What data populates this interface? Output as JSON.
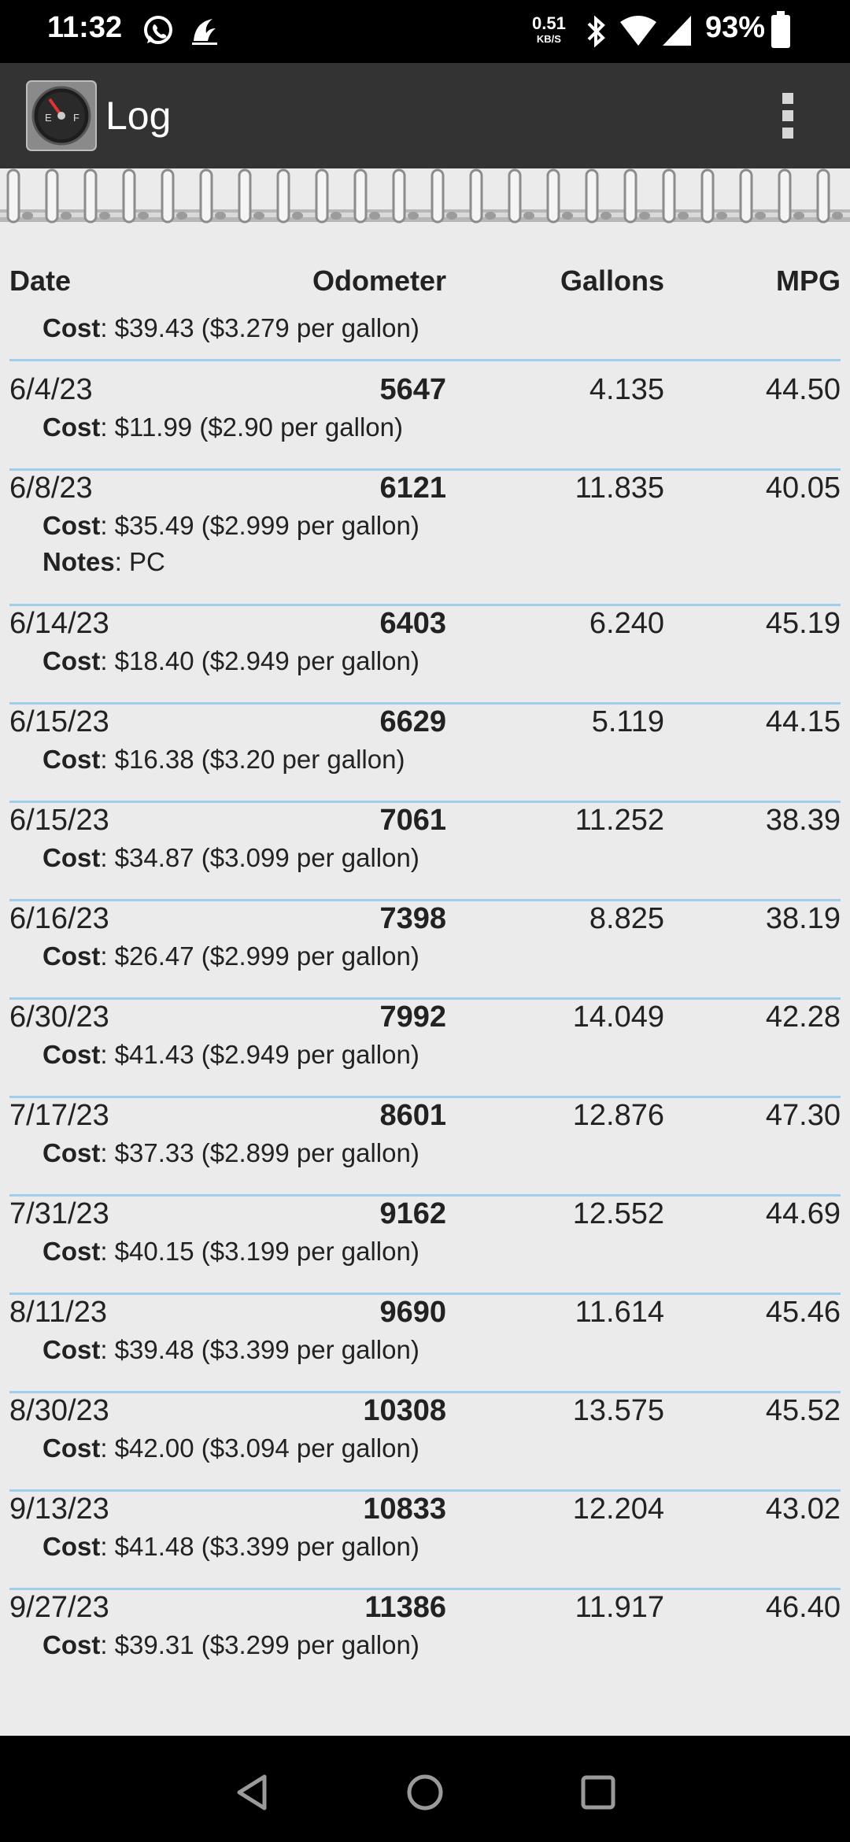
{
  "status_bar": {
    "time": "11:32",
    "net_speed_value": "0.51",
    "net_speed_unit": "KB/S",
    "battery": "93%"
  },
  "app_bar": {
    "title": "Log",
    "icon": "fuel-gauge-icon",
    "menu_icon": "overflow-menu-icon"
  },
  "table": {
    "headers": {
      "date": "Date",
      "odometer": "Odometer",
      "gallons": "Gallons",
      "mpg": "MPG"
    },
    "partial_first": {
      "cost_label": "Cost",
      "cost_text": ": $39.43 ($3.279 per gallon)"
    },
    "entries": [
      {
        "date": "6/4/23",
        "odometer": "5647",
        "gallons": "4.135",
        "mpg": "44.50",
        "cost_label": "Cost",
        "cost_text": ": $11.99 ($2.90 per gallon)"
      },
      {
        "date": "6/8/23",
        "odometer": "6121",
        "gallons": "11.835",
        "mpg": "40.05",
        "cost_label": "Cost",
        "cost_text": ": $35.49 ($2.999 per gallon)",
        "notes_label": "Notes",
        "notes_text": ": PC"
      },
      {
        "date": "6/14/23",
        "odometer": "6403",
        "gallons": "6.240",
        "mpg": "45.19",
        "cost_label": "Cost",
        "cost_text": ": $18.40 ($2.949 per gallon)"
      },
      {
        "date": "6/15/23",
        "odometer": "6629",
        "gallons": "5.119",
        "mpg": "44.15",
        "cost_label": "Cost",
        "cost_text": ": $16.38 ($3.20 per gallon)"
      },
      {
        "date": "6/15/23",
        "odometer": "7061",
        "gallons": "11.252",
        "mpg": "38.39",
        "cost_label": "Cost",
        "cost_text": ": $34.87 ($3.099 per gallon)"
      },
      {
        "date": "6/16/23",
        "odometer": "7398",
        "gallons": "8.825",
        "mpg": "38.19",
        "cost_label": "Cost",
        "cost_text": ": $26.47 ($2.999 per gallon)"
      },
      {
        "date": "6/30/23",
        "odometer": "7992",
        "gallons": "14.049",
        "mpg": "42.28",
        "cost_label": "Cost",
        "cost_text": ": $41.43 ($2.949 per gallon)"
      },
      {
        "date": "7/17/23",
        "odometer": "8601",
        "gallons": "12.876",
        "mpg": "47.30",
        "cost_label": "Cost",
        "cost_text": ": $37.33 ($2.899 per gallon)"
      },
      {
        "date": "7/31/23",
        "odometer": "9162",
        "gallons": "12.552",
        "mpg": "44.69",
        "cost_label": "Cost",
        "cost_text": ": $40.15 ($3.199 per gallon)"
      },
      {
        "date": "8/11/23",
        "odometer": "9690",
        "gallons": "11.614",
        "mpg": "45.46",
        "cost_label": "Cost",
        "cost_text": ": $39.48 ($3.399 per gallon)"
      },
      {
        "date": "8/30/23",
        "odometer": "10308",
        "gallons": "13.575",
        "mpg": "45.52",
        "cost_label": "Cost",
        "cost_text": ": $42.00 ($3.094 per gallon)"
      },
      {
        "date": "9/13/23",
        "odometer": "10833",
        "gallons": "12.204",
        "mpg": "43.02",
        "cost_label": "Cost",
        "cost_text": ": $41.48 ($3.399 per gallon)"
      },
      {
        "date": "9/27/23",
        "odometer": "11386",
        "gallons": "11.917",
        "mpg": "46.40",
        "cost_label": "Cost",
        "cost_text": ": $39.31 ($3.299 per gallon)"
      }
    ]
  },
  "nav_bar": {
    "back_icon": "back-triangle-icon",
    "home_icon": "home-circle-icon",
    "recents_icon": "recents-square-icon"
  },
  "colors": {
    "app_bar": "#333333",
    "content_bg": "#ebebeb",
    "divider": "#9fcfea"
  }
}
